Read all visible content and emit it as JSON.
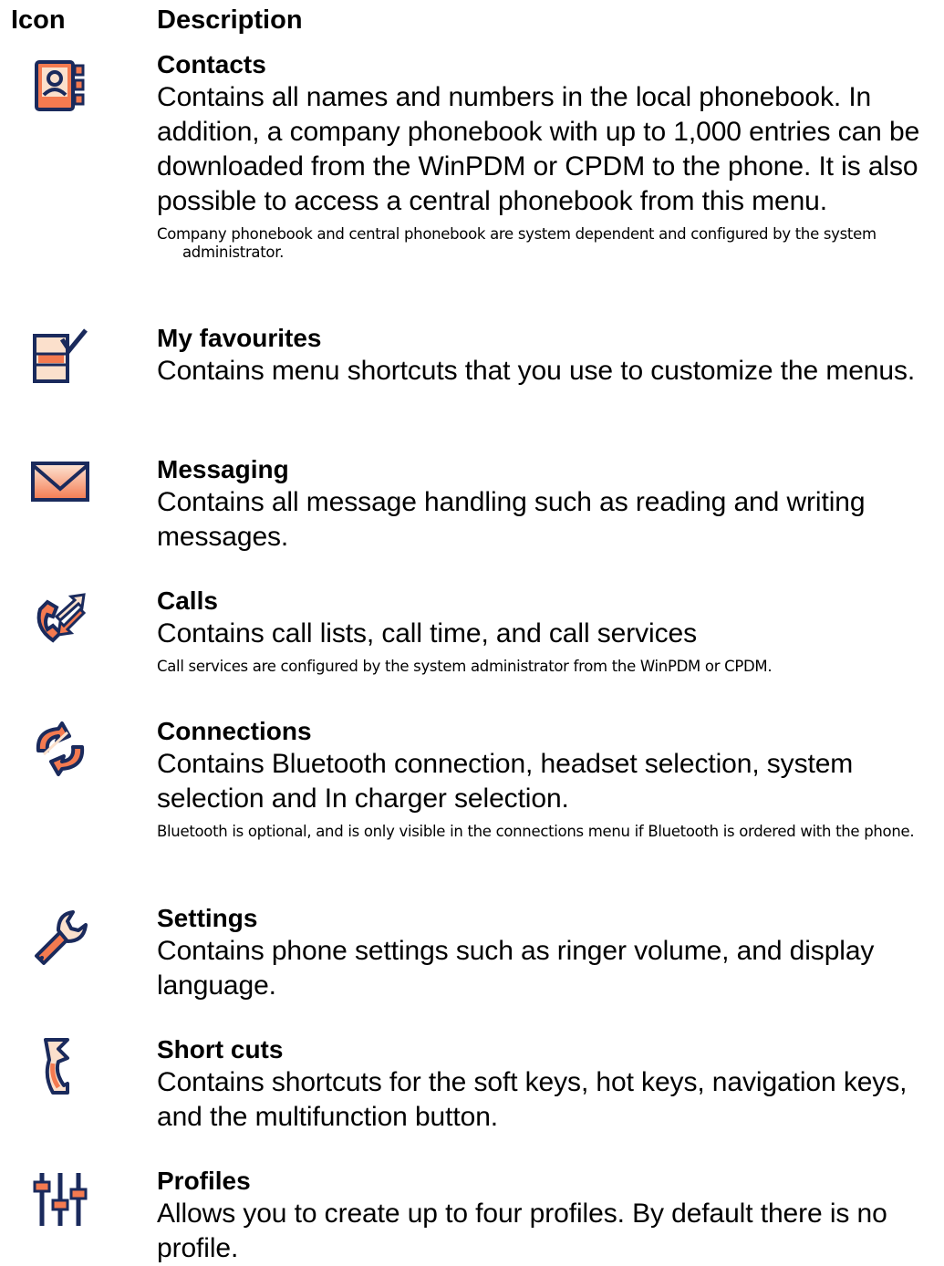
{
  "header": {
    "icon_col": "Icon",
    "desc_col": "Description"
  },
  "colors": {
    "icon_fill": "#f47a50",
    "icon_light": "#fbe0cc",
    "icon_outline": "#1a2a5c"
  },
  "rows": [
    {
      "icon": "contacts-icon",
      "title": "Contacts",
      "text": "Contains all names and numbers in the local phonebook. In addition, a company phonebook with up to 1,000 entries  can be downloaded from the WinPDM or CPDM to the phone. It is also possible to access a central phonebook from this menu.",
      "note": "Company phonebook and central phonebook are system dependent and configured by the system administrator."
    },
    {
      "icon": "favourites-icon",
      "title": "My favourites",
      "text": "Contains menu shortcuts that you use to customize the menus."
    },
    {
      "icon": "messaging-icon",
      "title": "Messaging",
      "text": "Contains all message handling such as reading and writing messages."
    },
    {
      "icon": "calls-icon",
      "title": "Calls",
      "text": "Contains call lists, call time, and call services",
      "note": "Call services are configured by the system administrator from the WinPDM or CPDM."
    },
    {
      "icon": "connections-icon",
      "title": "Connections",
      "text": "Contains Bluetooth connection, headset selection, system selection and In charger selection.",
      "note": "Bluetooth is optional, and is only visible in the connections menu if Bluetooth is ordered with the phone."
    },
    {
      "icon": "settings-icon",
      "title": "Settings",
      "text": "Contains phone settings such as ringer volume, and display language."
    },
    {
      "icon": "shortcuts-icon",
      "title": "Short cuts",
      "text": "Contains shortcuts for the soft keys, hot keys, navigation keys, and the multifunction button."
    },
    {
      "icon": "profiles-icon",
      "title": "Profiles",
      "text": "Allows you to create up to four profiles. By default there is no profile."
    }
  ]
}
